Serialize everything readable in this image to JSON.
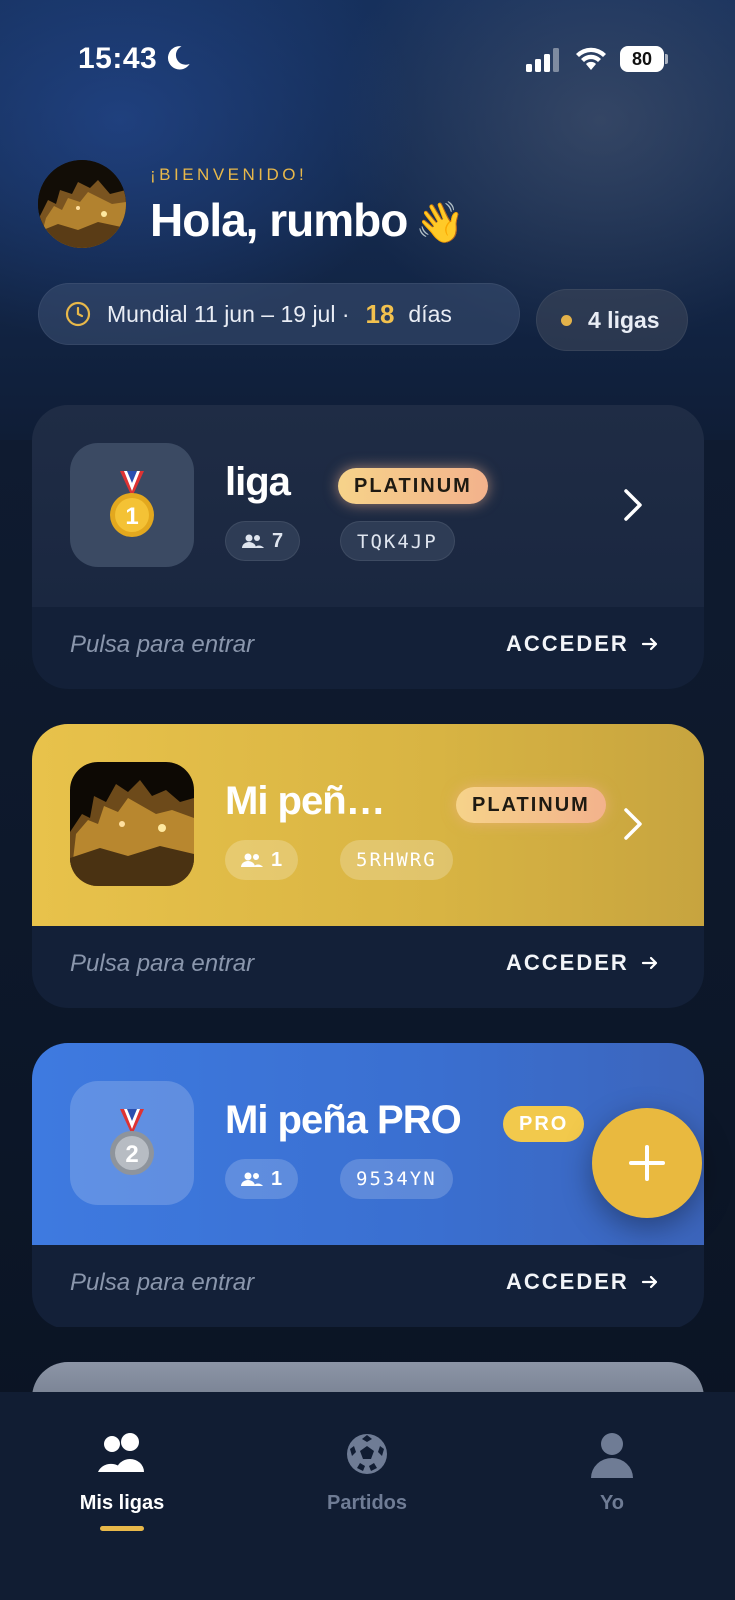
{
  "status_bar": {
    "time": "15:43",
    "battery": "80"
  },
  "header": {
    "welcome": "¡BIENVENIDO!",
    "greeting": "Hola, rumbo",
    "wave_emoji": "👋",
    "tournament_text": "Mundial 11 jun – 19 jul ·",
    "days_count": "18",
    "days_label": "días",
    "leagues_count_label": "4 ligas"
  },
  "leagues": [
    {
      "name": "liga",
      "tier": "PLATINUM",
      "members": "7",
      "code": "TQK4JP",
      "hint": "Pulsa para entrar",
      "action": "ACCEDER",
      "thumb": "gold-medal-icon"
    },
    {
      "name": "Mi peñ…",
      "tier": "PLATINUM",
      "members": "1",
      "code": "5RHWRG",
      "hint": "Pulsa para entrar",
      "action": "ACCEDER",
      "thumb": "castle-photo"
    },
    {
      "name": "Mi peña PRO",
      "tier": "PRO",
      "members": "1",
      "code": "9534YN",
      "hint": "Pulsa para entrar",
      "action": "ACCEDER",
      "thumb": "silver-medal-icon"
    }
  ],
  "colors": {
    "accent": "#E8B84A",
    "gold_card": "#E0BC48",
    "blue_card": "#3E7AE0",
    "dark_card": "#1F2C45"
  },
  "nav": {
    "tabs": [
      {
        "label": "Mis ligas",
        "icon": "users-icon",
        "active": true
      },
      {
        "label": "Partidos",
        "icon": "soccer-ball-icon",
        "active": false
      },
      {
        "label": "Yo",
        "icon": "user-icon",
        "active": false
      }
    ]
  }
}
